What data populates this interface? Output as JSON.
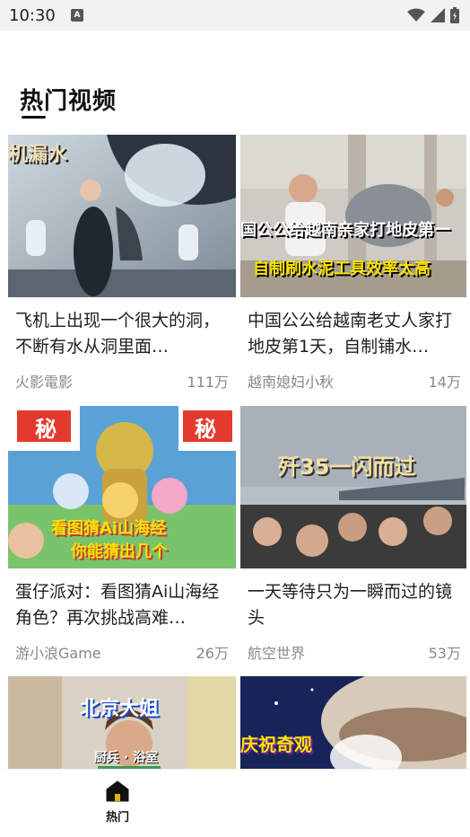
{
  "status_bar": {
    "time": "10:30",
    "badge": "A"
  },
  "section": {
    "title": "热门视频"
  },
  "videos": [
    {
      "title": "飞机上出现一个很大的洞，不断有水从洞里面…",
      "author": "火影電影",
      "views": "111万",
      "overlay": "机漏水"
    },
    {
      "title": "中国公公给越南老丈人家打地皮第1天，自制铺水…",
      "author": "越南媳妇小秋",
      "views": "14万",
      "overlay": "国公公给越南亲家打地皮第一",
      "overlay2": "自制刷水泥工具效率太高"
    },
    {
      "title": "蛋仔派对：看图猜Ai山海经角色？再次挑战高难…",
      "author": "游小浪Game",
      "views": "26万",
      "overlay": "看图猜Ai山海经",
      "overlay2": "你能猜出几个",
      "badge": "秘"
    },
    {
      "title": "一天等待只为一瞬而过的镜头",
      "author": "航空世界",
      "views": "53万",
      "overlay": "歼35一闪而过"
    },
    {
      "title": "",
      "author": "",
      "views": "",
      "overlay": "北京大姐",
      "overlay2": "厨兵 · 浴室"
    },
    {
      "title": "",
      "author": "",
      "views": "",
      "overlay": "庆祝奇观"
    }
  ],
  "nav": {
    "home_label": "热门"
  },
  "colors": {
    "accent": "#111111",
    "muted": "#888888"
  }
}
